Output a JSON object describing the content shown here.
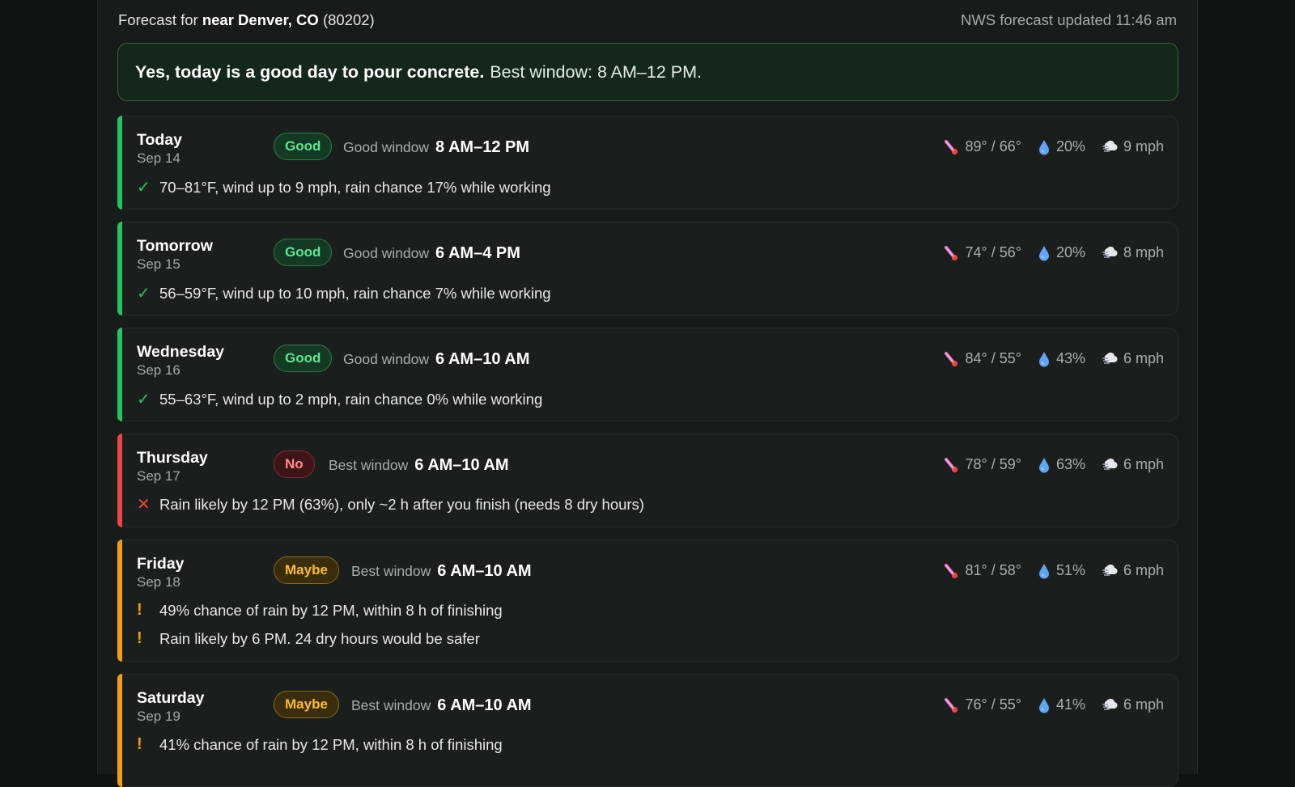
{
  "header": {
    "prefix": "Forecast for",
    "location": "near Denver, CO",
    "zip": "(80202)",
    "updated": "NWS forecast updated 11:46 am"
  },
  "banner": {
    "verdict": "Yes, today is a good day to pour concrete.",
    "detail": "Best window: 8 AM–12 PM."
  },
  "icons": {
    "temp": "thermometer-icon",
    "rain": "raindrop-icon",
    "wind": "wind-icon"
  },
  "colors": {
    "good": "#22c55e",
    "no": "#ef4444",
    "maybe": "#f59e0b"
  },
  "days": [
    {
      "name": "Today",
      "date": "Sep 14",
      "status": "Good",
      "window_label": "Good window",
      "window": "8 AM–12 PM",
      "temp": "89° / 66°",
      "rain": "20%",
      "wind": "9 mph",
      "reasons": [
        {
          "mark": "✓",
          "text": "70–81°F, wind up to 9 mph, rain chance 17% while working"
        }
      ]
    },
    {
      "name": "Tomorrow",
      "date": "Sep 15",
      "status": "Good",
      "window_label": "Good window",
      "window": "6 AM–4 PM",
      "temp": "74° / 56°",
      "rain": "20%",
      "wind": "8 mph",
      "reasons": [
        {
          "mark": "✓",
          "text": "56–59°F, wind up to 10 mph, rain chance 7% while working"
        }
      ]
    },
    {
      "name": "Wednesday",
      "date": "Sep 16",
      "status": "Good",
      "window_label": "Good window",
      "window": "6 AM–10 AM",
      "temp": "84° / 55°",
      "rain": "43%",
      "wind": "6 mph",
      "reasons": [
        {
          "mark": "✓",
          "text": "55–63°F, wind up to 2 mph, rain chance 0% while working"
        }
      ]
    },
    {
      "name": "Thursday",
      "date": "Sep 17",
      "status": "No",
      "window_label": "Best window",
      "window": "6 AM–10 AM",
      "temp": "78° / 59°",
      "rain": "63%",
      "wind": "6 mph",
      "reasons": [
        {
          "mark": "✕",
          "text": "Rain likely by 12 PM (63%), only ~2 h after you finish (needs 8 dry hours)"
        }
      ]
    },
    {
      "name": "Friday",
      "date": "Sep 18",
      "status": "Maybe",
      "window_label": "Best window",
      "window": "6 AM–10 AM",
      "temp": "81° / 58°",
      "rain": "51%",
      "wind": "6 mph",
      "reasons": [
        {
          "mark": "!",
          "text": "49% chance of rain by 12 PM, within 8 h of finishing"
        },
        {
          "mark": "!",
          "text": "Rain likely by 6 PM. 24 dry hours would be safer"
        }
      ]
    },
    {
      "name": "Saturday",
      "date": "Sep 19",
      "status": "Maybe",
      "window_label": "Best window",
      "window": "6 AM–10 AM",
      "temp": "76° / 55°",
      "rain": "41%",
      "wind": "6 mph",
      "reasons": [
        {
          "mark": "!",
          "text": "41% chance of rain by 12 PM, within 8 h of finishing"
        }
      ]
    }
  ]
}
